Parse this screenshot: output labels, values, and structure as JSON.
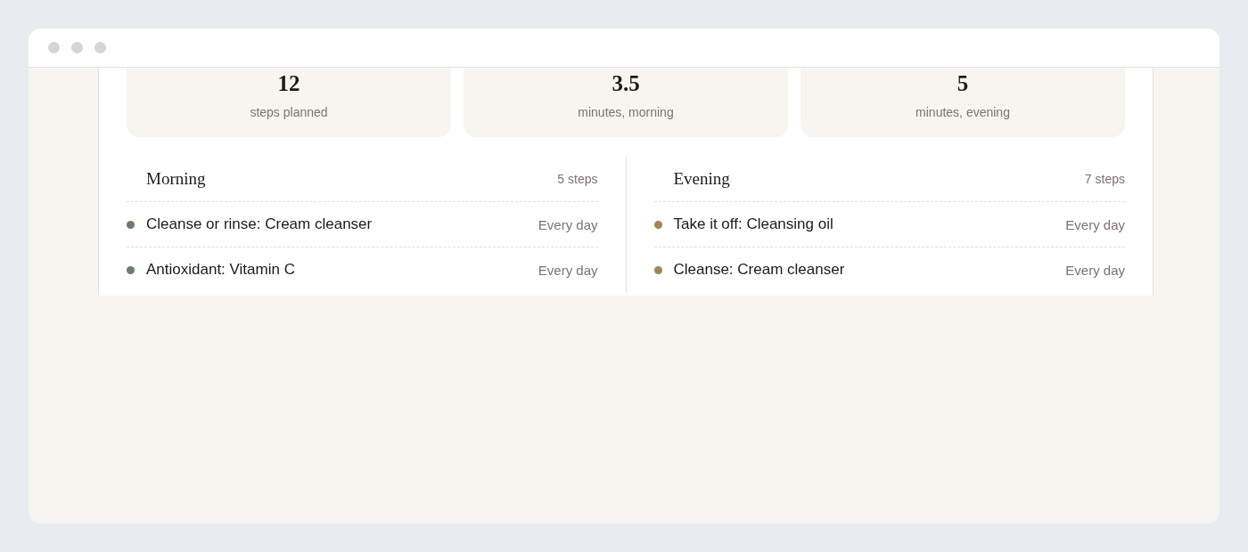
{
  "stats": [
    {
      "value": "12",
      "label": "steps planned"
    },
    {
      "value": "3.5",
      "label": "minutes, morning"
    },
    {
      "value": "5",
      "label": "minutes, evening"
    }
  ],
  "routines": [
    {
      "title": "Morning",
      "count": "5 steps",
      "steps": [
        {
          "name": "Cleanse or rinse: Cream cleanser",
          "frequency": "Every day",
          "color": "#6f7d68"
        },
        {
          "name": "Antioxidant: Vitamin C",
          "frequency": "Every day",
          "color": "#6f7d68"
        }
      ]
    },
    {
      "title": "Evening",
      "count": "7 steps",
      "steps": [
        {
          "name": "Take it off: Cleansing oil",
          "frequency": "Every day",
          "color": "#a88355"
        },
        {
          "name": "Cleanse: Cream cleanser",
          "frequency": "Every day",
          "color": "#a88355"
        }
      ]
    }
  ]
}
